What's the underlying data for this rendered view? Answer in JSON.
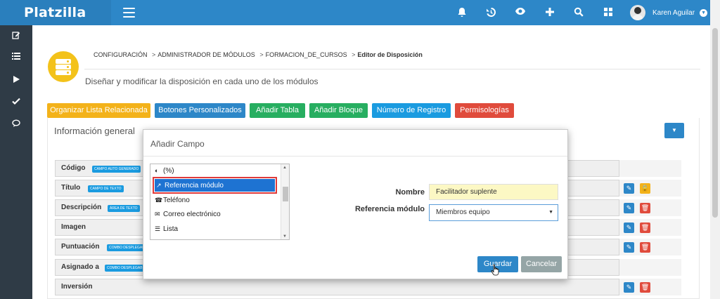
{
  "app": {
    "brand": "Platzilla"
  },
  "user": {
    "name": "Karen Aguilar"
  },
  "breadcrumb": [
    "CONFIGURACIÓN",
    "ADMINISTRADOR DE MÓDULOS",
    "FORMACION_DE_CURSOS",
    "Editor de Disposición"
  ],
  "page": {
    "subtitle": "Diseñar y modificar la disposición en cada uno de los módulos"
  },
  "toolbar": [
    {
      "label": "Organizar Lista Relacionada",
      "color": "#f3b21a"
    },
    {
      "label": "Botones Personalizados",
      "color": "#2d87c8"
    },
    {
      "label": "Añadir Tabla",
      "color": "#27ae60"
    },
    {
      "label": "Añadir Bloque",
      "color": "#27ae60"
    },
    {
      "label": "Número de Registro",
      "color": "#1a9be0"
    },
    {
      "label": "Permisologías",
      "color": "#e04b3c"
    }
  ],
  "panel": {
    "title": "Información general"
  },
  "fields": [
    {
      "label": "Código",
      "badge": "CAMPO AUTO GENERADO"
    },
    {
      "label": "Título",
      "badge": "CAMPO DE TEXTO"
    },
    {
      "label": "Descripción",
      "badge": "ÁREA DE TEXTO"
    },
    {
      "label": "Imagen",
      "badge": ""
    },
    {
      "label": "Puntuación",
      "badge": "COMBO DESPLEGABLE"
    },
    {
      "label": "Asignado a",
      "badge": "COMBO DESPLEGABLE"
    },
    {
      "label": "Inversión",
      "badge": ""
    }
  ],
  "modal": {
    "title": "Añadir Campo",
    "list": [
      {
        "icon": "half-circle-icon",
        "label": "(%)"
      },
      {
        "icon": "external-link-icon",
        "label": "Referencia módulo"
      },
      {
        "icon": "phone-icon",
        "label": "Teléfono"
      },
      {
        "icon": "envelope-icon",
        "label": "Correo electrónico"
      },
      {
        "icon": "list-icon",
        "label": "Lista"
      }
    ],
    "selected_index": 1,
    "name_label": "Nombre",
    "name_value": "Facilitador suplente",
    "ref_label": "Referencia módulo",
    "ref_value": "Miembros equipo",
    "save": "Guardar",
    "cancel": "Cancelar"
  },
  "colors": {
    "primary": "#2d87c8",
    "sidebar": "#2f3b46",
    "selected": "#1e73d2",
    "highlight": "#e03a3a"
  }
}
